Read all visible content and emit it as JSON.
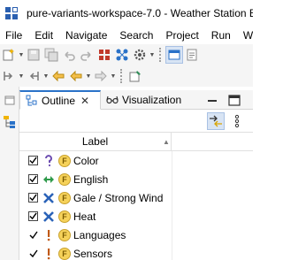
{
  "window": {
    "title": "pure-variants-workspace-7.0 - Weather Station E"
  },
  "menu": [
    {
      "label": "File"
    },
    {
      "label": "Edit"
    },
    {
      "label": "Navigate"
    },
    {
      "label": "Search"
    },
    {
      "label": "Project"
    },
    {
      "label": "Run"
    },
    {
      "label": "Win"
    }
  ],
  "tabs": {
    "outline": {
      "label": "Outline",
      "icon": "outline-icon",
      "active": true
    },
    "visualization": {
      "label": "Visualization",
      "icon": "glasses-icon",
      "active": false
    }
  },
  "table": {
    "header": "Label",
    "rows": [
      {
        "selection": "checked",
        "status": "question-icon",
        "badge": "F",
        "label": "Color"
      },
      {
        "selection": "checked",
        "status": "double-arrow-icon",
        "badge": "F",
        "label": "English"
      },
      {
        "selection": "checked",
        "status": "cross-icon",
        "badge": "F",
        "label": "Gale / Strong Wind"
      },
      {
        "selection": "checked",
        "status": "cross-icon",
        "badge": "F",
        "label": "Heat"
      },
      {
        "selection": "tick",
        "status": "exclamation-icon",
        "badge": "F",
        "label": "Languages"
      },
      {
        "selection": "tick",
        "status": "exclamation-icon",
        "badge": "F",
        "label": "Sensors"
      }
    ]
  },
  "colors": {
    "accent": "#2a72c8",
    "feature_badge": "#f6d25a",
    "toolbar_bg": "#f5f5f5"
  }
}
